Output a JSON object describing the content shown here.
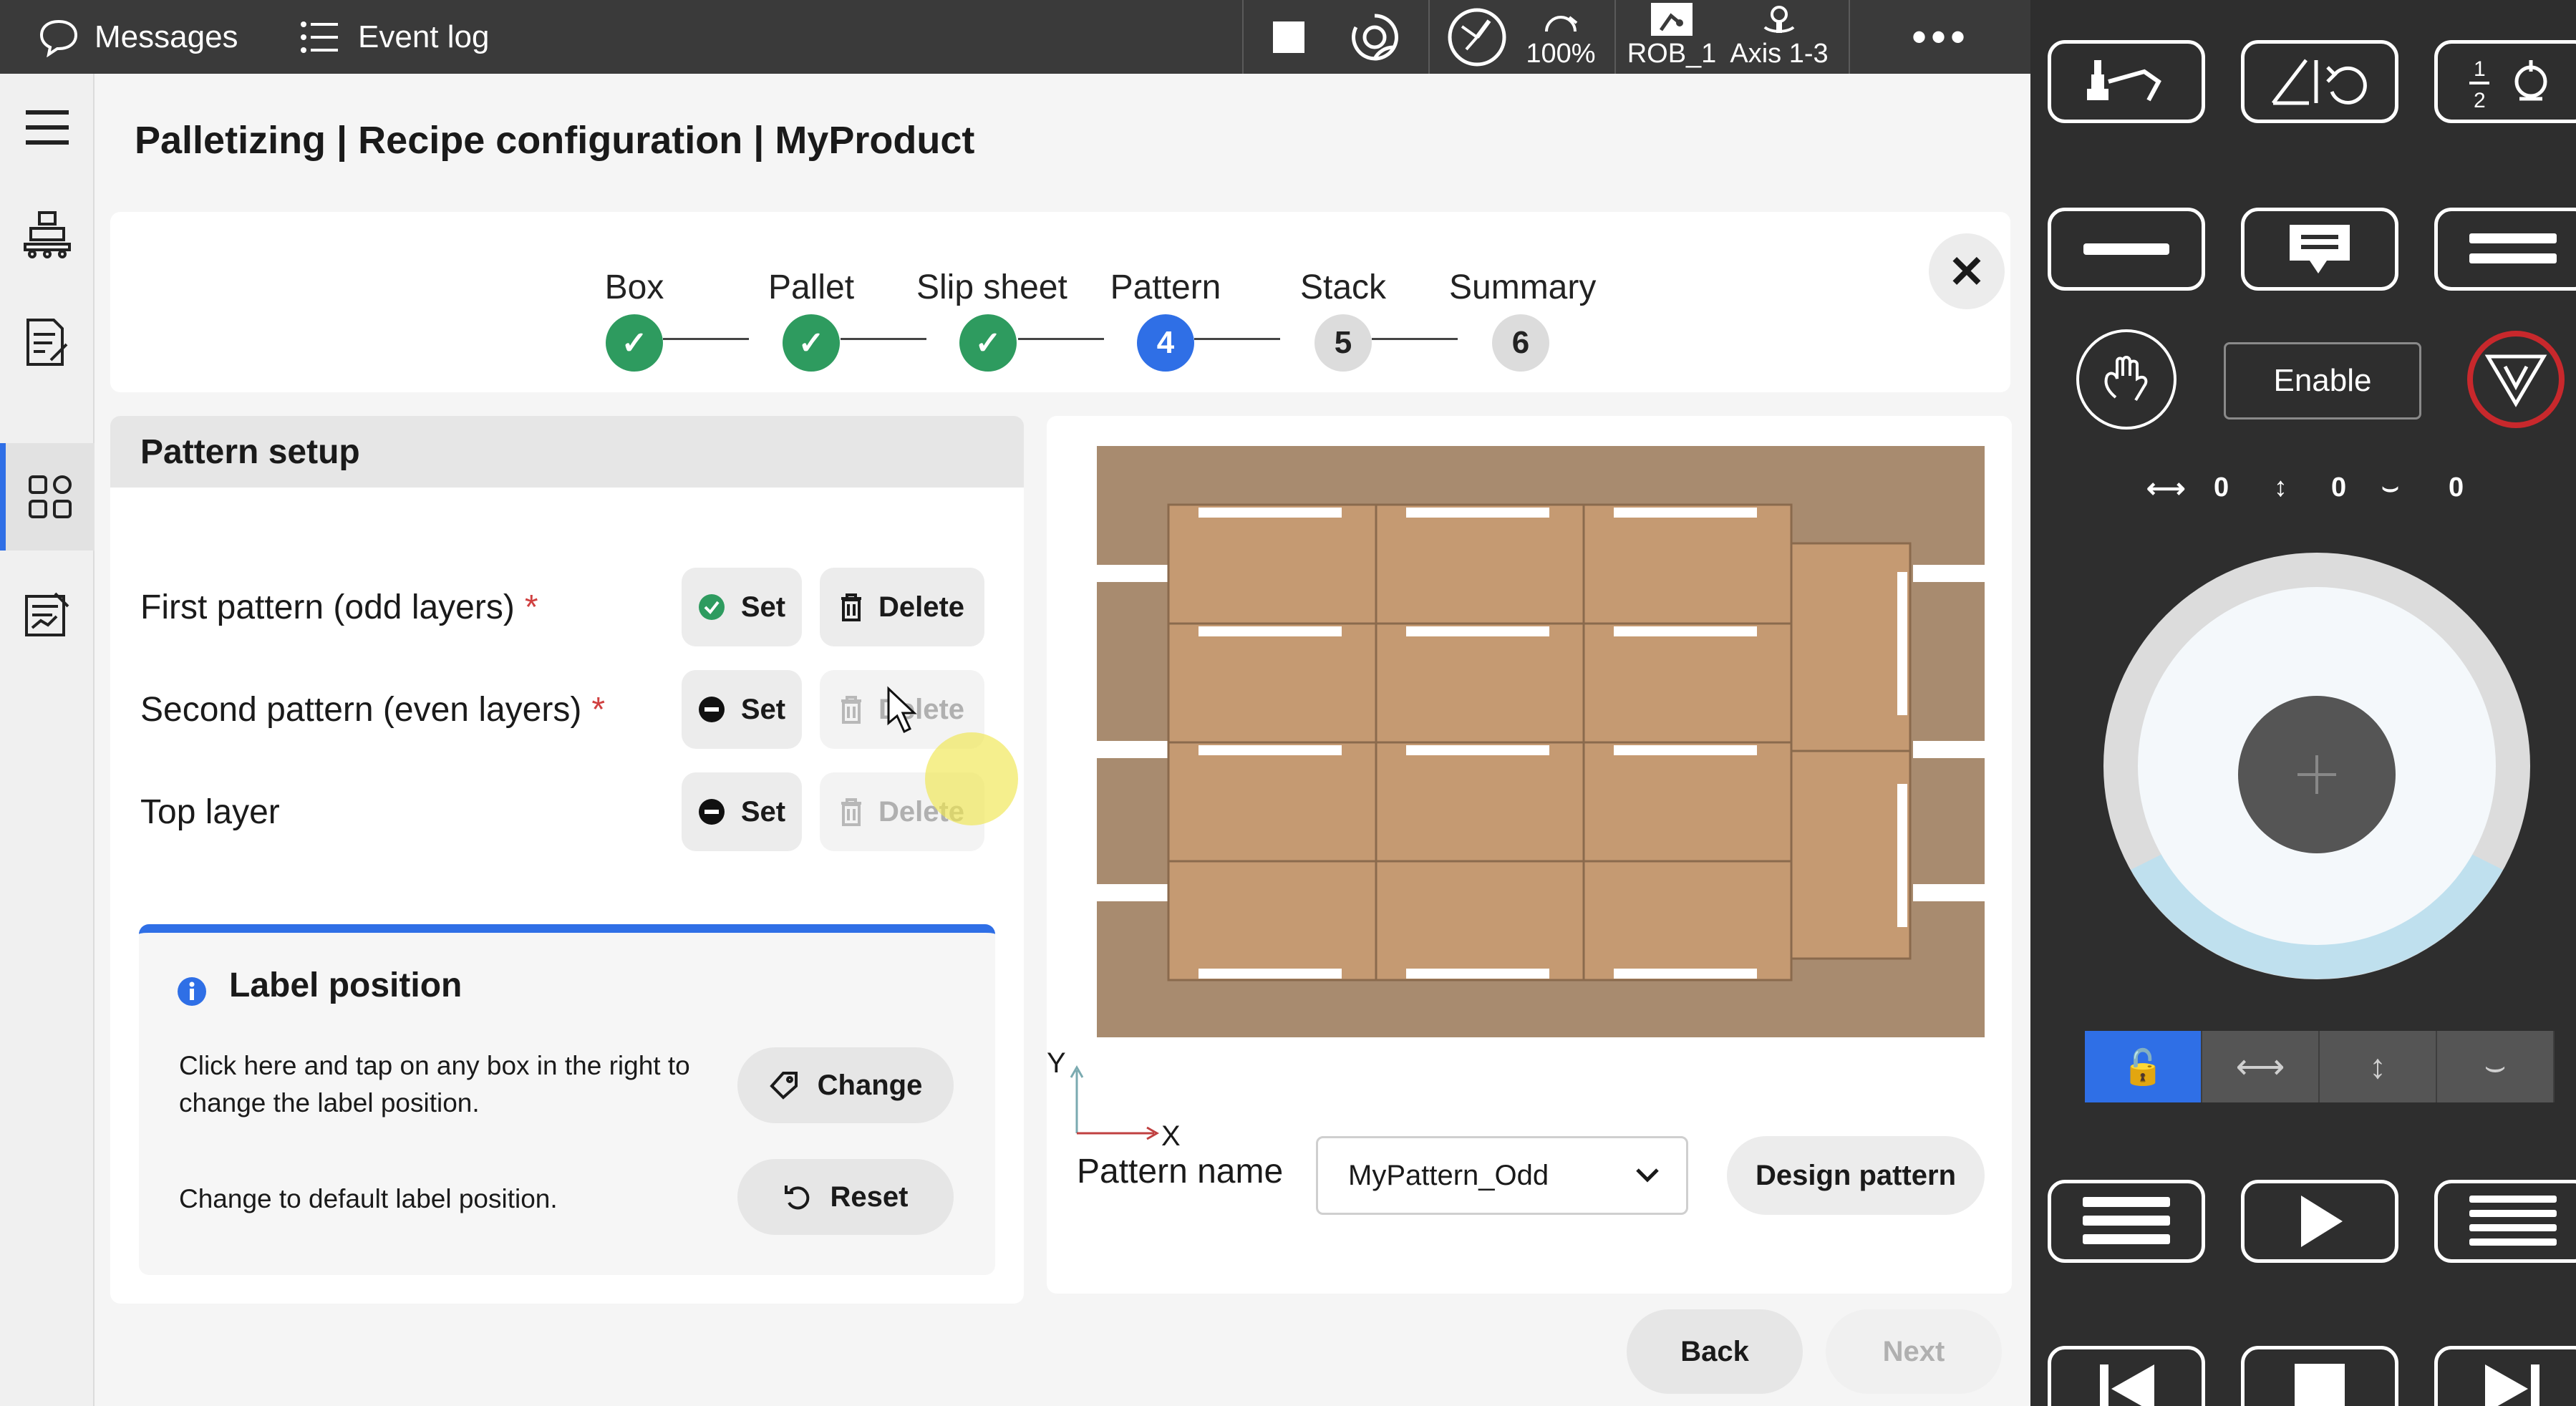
{
  "topbar": {
    "messages_label": "Messages",
    "event_log_label": "Event log",
    "speed": "100%",
    "mech_unit": "ROB_1",
    "motion_mode": "Axis 1-3"
  },
  "header": {
    "title": "Palletizing | Recipe configuration | MyProduct"
  },
  "stepper": {
    "steps": [
      {
        "label": "Box",
        "status": "done",
        "marker": "✓"
      },
      {
        "label": "Pallet",
        "status": "done",
        "marker": "✓"
      },
      {
        "label": "Slip sheet",
        "status": "done",
        "marker": "✓"
      },
      {
        "label": "Pattern",
        "status": "current",
        "marker": "4"
      },
      {
        "label": "Stack",
        "status": "todo",
        "marker": "5"
      },
      {
        "label": "Summary",
        "status": "todo",
        "marker": "6"
      }
    ]
  },
  "pattern_setup": {
    "title": "Pattern setup",
    "rows": [
      {
        "label": "First pattern (odd layers)",
        "required": "*",
        "set_label": "Set",
        "delete_label": "Delete",
        "is_set": true,
        "delete_enabled": true
      },
      {
        "label": "Second pattern (even layers)",
        "required": "*",
        "set_label": "Set",
        "delete_label": "Delete",
        "is_set": false,
        "delete_enabled": false
      },
      {
        "label": "Top layer",
        "required": "",
        "set_label": "Set",
        "delete_label": "Delete",
        "is_set": false,
        "delete_enabled": false
      }
    ],
    "label_position": {
      "title": "Label position",
      "change_text_line1": "Click here and tap on any box in the right to",
      "change_text_line2": "change the label position.",
      "change_button": "Change",
      "reset_text": "Change to default label position.",
      "reset_button": "Reset"
    }
  },
  "preview": {
    "axis_y": "Y",
    "axis_x": "X",
    "pattern_name_label": "Pattern name",
    "pattern_name_value": "MyPattern_Odd",
    "design_button": "Design pattern"
  },
  "footer": {
    "back_label": "Back",
    "next_label": "Next"
  },
  "flexpendant": {
    "enable_label": "Enable",
    "jog_x": "0",
    "jog_y": "0",
    "jog_rot": "0"
  },
  "colors": {
    "accent": "#2f6fe6",
    "done_green": "#2e9b5f",
    "pallet": "#a88b6f",
    "box": "#c59a72",
    "label_strip": "#ffffff"
  }
}
